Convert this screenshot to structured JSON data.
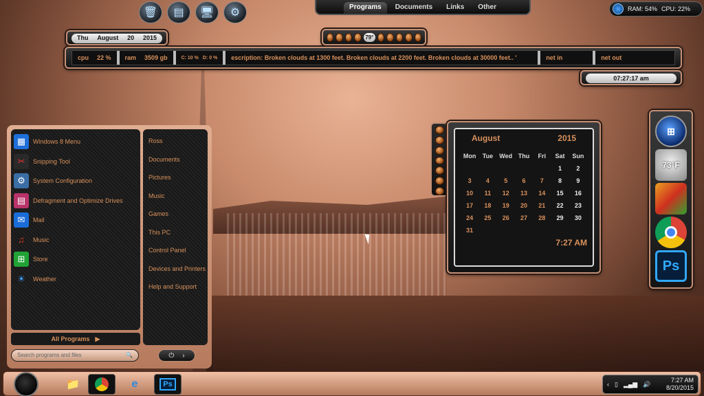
{
  "top_icons": [
    "recycle-bin-icon",
    "control-panel-icon",
    "computer-icon",
    "settings-icon"
  ],
  "topnav": {
    "tabs": [
      "Programs",
      "Documents",
      "Links",
      "Other"
    ],
    "active": "Programs"
  },
  "sysmon": {
    "ram": "RAM: 54%",
    "cpu": "CPU: 22%"
  },
  "datebar": {
    "day": "Thu",
    "month": "August",
    "date": "20",
    "year": "2015"
  },
  "weather_widget": {
    "temp": "79°"
  },
  "infobar": {
    "cpu_label": "cpu",
    "cpu_value": "22 %",
    "ram_label": "ram",
    "ram_value": "3509 gb",
    "c_drive": "C:  10 %",
    "d_drive": "D:  0 %",
    "weather_text": "escription: Broken clouds at 1300 feet. Broken clouds at 2200 feet. Broken clouds at 30000 feet.. '",
    "net_in": "net in",
    "net_out": "net out"
  },
  "timebar": {
    "time": "07:27:17 am"
  },
  "start_menu": {
    "programs": [
      {
        "label": "Windows 8 Menu",
        "icon": "windows8-menu-icon",
        "color": "#1e6fd9",
        "glyph": "▦"
      },
      {
        "label": "Snipping Tool",
        "icon": "scissors-icon",
        "color": "#2a2a2a",
        "glyph": "✂"
      },
      {
        "label": "System Configuration",
        "icon": "system-config-icon",
        "color": "#3a6ea5",
        "glyph": "⚙"
      },
      {
        "label": "Defragment and Optimize Drives",
        "icon": "defrag-icon",
        "color": "#b8336a",
        "glyph": "▤"
      },
      {
        "label": "Mail",
        "icon": "mail-icon",
        "color": "#1a6dd9",
        "glyph": "✉"
      },
      {
        "label": "Music",
        "icon": "headphones-icon",
        "color": "#c0392b",
        "glyph": "♫"
      },
      {
        "label": "Store",
        "icon": "store-icon",
        "color": "#21a336",
        "glyph": "⊞"
      },
      {
        "label": "Weather",
        "icon": "weather-icon",
        "color": "#1e88e5",
        "glyph": "☀"
      }
    ],
    "places": [
      "Ross",
      "Documents",
      "Pictures",
      "Music",
      "Games",
      "This PC",
      "Control Panel",
      "Devices and Printers",
      "Help and Support"
    ],
    "all_programs": "All Programs",
    "search_placeholder": "Search programs and files"
  },
  "calendar": {
    "month": "August",
    "year": "2015",
    "dows": [
      "Mon",
      "Tue",
      "Wed",
      "Thu",
      "Fri",
      "Sat",
      "Sun"
    ],
    "weeks": [
      [
        "",
        "",
        "",
        "",
        "",
        "1",
        "2"
      ],
      [
        "3",
        "4",
        "5",
        "6",
        "7",
        "8",
        "9"
      ],
      [
        "10",
        "11",
        "12",
        "13",
        "14",
        "15",
        "16"
      ],
      [
        "17",
        "18",
        "19",
        "20",
        "21",
        "22",
        "23"
      ],
      [
        "24",
        "25",
        "26",
        "27",
        "28",
        "29",
        "30"
      ],
      [
        "31",
        "",
        "",
        "",
        "",
        "",
        ""
      ]
    ],
    "time": "7:27 AM"
  },
  "dock": {
    "items": [
      {
        "name": "windows-orb-icon",
        "label": ""
      },
      {
        "name": "weather-cloud-icon",
        "label": "73°F"
      },
      {
        "name": "avast-icon",
        "label": ""
      },
      {
        "name": "chrome-icon",
        "label": ""
      },
      {
        "name": "photoshop-icon",
        "label": "Ps"
      }
    ]
  },
  "taskbar": {
    "buttons": [
      "file-explorer-icon",
      "chrome-icon",
      "ie-firefox-icon",
      "photoshop-icon"
    ],
    "photoshop_label": "Ps",
    "clock_time": "7:27 AM",
    "clock_date": "8/20/2015"
  },
  "colors": {
    "accent": "#d9915c",
    "frame": "#c49076"
  }
}
